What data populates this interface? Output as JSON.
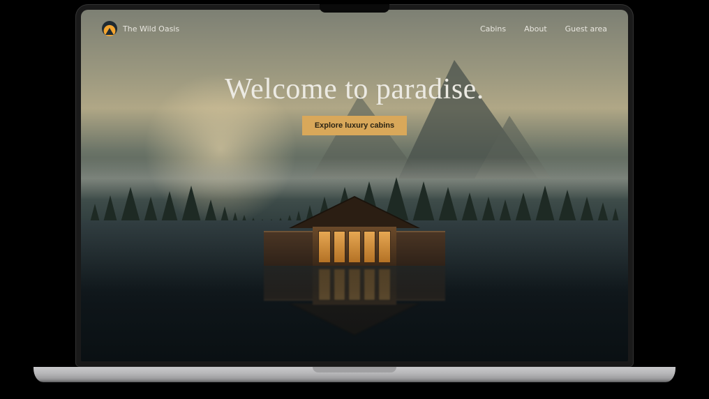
{
  "brand": {
    "name": "The Wild Oasis"
  },
  "nav": {
    "links": [
      {
        "label": "Cabins"
      },
      {
        "label": "About"
      },
      {
        "label": "Guest area"
      }
    ]
  },
  "hero": {
    "headline": "Welcome to paradise.",
    "cta_label": "Explore luxury cabins"
  },
  "colors": {
    "accent": "#d9a85a",
    "text_light": "#eceae3"
  }
}
